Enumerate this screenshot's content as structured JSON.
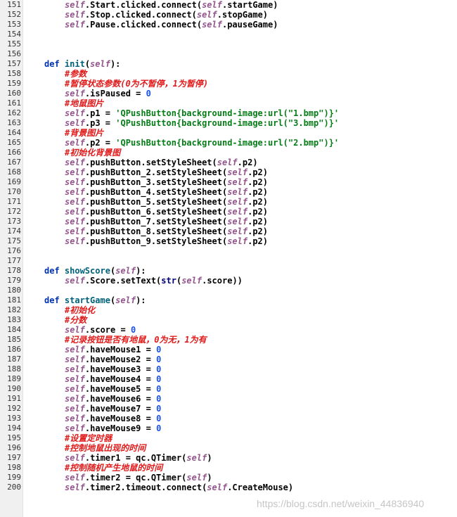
{
  "colors": {
    "self": "#94558d",
    "keyword": "#0033b3",
    "function": "#00627a",
    "number": "#1750eb",
    "string": "#067d17",
    "comment": "#e01b1b",
    "builtin": "#000080"
  },
  "watermark": "https://blog.csdn.net/weixin_44836940",
  "lines": [
    {
      "n": "151",
      "indent": 2,
      "tokens": [
        [
          "self",
          "self"
        ],
        [
          "plain",
          ".Start.clicked.connect("
        ],
        [
          "self",
          "self"
        ],
        [
          "plain",
          ".startGame)"
        ]
      ]
    },
    {
      "n": "152",
      "indent": 2,
      "tokens": [
        [
          "self",
          "self"
        ],
        [
          "plain",
          ".Stop.clicked.connect("
        ],
        [
          "self",
          "self"
        ],
        [
          "plain",
          ".stopGame)"
        ]
      ]
    },
    {
      "n": "153",
      "indent": 2,
      "tokens": [
        [
          "self",
          "self"
        ],
        [
          "plain",
          ".Pause.clicked.connect("
        ],
        [
          "self",
          "self"
        ],
        [
          "plain",
          ".pauseGame)"
        ]
      ]
    },
    {
      "n": "154",
      "indent": 0,
      "tokens": []
    },
    {
      "n": "155",
      "indent": 0,
      "tokens": []
    },
    {
      "n": "156",
      "indent": 0,
      "tokens": []
    },
    {
      "n": "157",
      "indent": 1,
      "tokens": [
        [
          "kw",
          "def "
        ],
        [
          "fn",
          "init"
        ],
        [
          "plain",
          "("
        ],
        [
          "self",
          "self"
        ],
        [
          "plain",
          "):"
        ]
      ]
    },
    {
      "n": "158",
      "indent": 2,
      "tokens": [
        [
          "cmt",
          "#参数"
        ]
      ]
    },
    {
      "n": "159",
      "indent": 2,
      "tokens": [
        [
          "cmt",
          "#暂停状态参数(0为不暂停，1为暂停)"
        ]
      ]
    },
    {
      "n": "160",
      "indent": 2,
      "tokens": [
        [
          "self",
          "self"
        ],
        [
          "plain",
          ".isPaused = "
        ],
        [
          "num",
          "0"
        ]
      ]
    },
    {
      "n": "161",
      "indent": 2,
      "tokens": [
        [
          "cmt",
          "#地鼠图片"
        ]
      ]
    },
    {
      "n": "162",
      "indent": 2,
      "tokens": [
        [
          "self",
          "self"
        ],
        [
          "plain",
          ".p1 = "
        ],
        [
          "str",
          "'QPushButton{background-image:url(\"1.bmp\")}'"
        ]
      ]
    },
    {
      "n": "163",
      "indent": 2,
      "tokens": [
        [
          "self",
          "self"
        ],
        [
          "plain",
          ".p3 = "
        ],
        [
          "str",
          "'QPushButton{background-image:url(\"3.bmp\")}'"
        ]
      ]
    },
    {
      "n": "164",
      "indent": 2,
      "tokens": [
        [
          "cmt",
          "#背景图片"
        ]
      ]
    },
    {
      "n": "165",
      "indent": 2,
      "tokens": [
        [
          "self",
          "self"
        ],
        [
          "plain",
          ".p2 = "
        ],
        [
          "str",
          "'QPushButton{background-image:url(\"2.bmp\")}'"
        ]
      ]
    },
    {
      "n": "166",
      "indent": 2,
      "tokens": [
        [
          "cmt",
          "#初始化背景图"
        ]
      ]
    },
    {
      "n": "167",
      "indent": 2,
      "tokens": [
        [
          "self",
          "self"
        ],
        [
          "plain",
          ".pushButton.setStyleSheet("
        ],
        [
          "self",
          "self"
        ],
        [
          "plain",
          ".p2)"
        ]
      ]
    },
    {
      "n": "168",
      "indent": 2,
      "tokens": [
        [
          "self",
          "self"
        ],
        [
          "plain",
          ".pushButton_2.setStyleSheet("
        ],
        [
          "self",
          "self"
        ],
        [
          "plain",
          ".p2)"
        ]
      ]
    },
    {
      "n": "169",
      "indent": 2,
      "tokens": [
        [
          "self",
          "self"
        ],
        [
          "plain",
          ".pushButton_3.setStyleSheet("
        ],
        [
          "self",
          "self"
        ],
        [
          "plain",
          ".p2)"
        ]
      ]
    },
    {
      "n": "170",
      "indent": 2,
      "tokens": [
        [
          "self",
          "self"
        ],
        [
          "plain",
          ".pushButton_4.setStyleSheet("
        ],
        [
          "self",
          "self"
        ],
        [
          "plain",
          ".p2)"
        ]
      ]
    },
    {
      "n": "171",
      "indent": 2,
      "tokens": [
        [
          "self",
          "self"
        ],
        [
          "plain",
          ".pushButton_5.setStyleSheet("
        ],
        [
          "self",
          "self"
        ],
        [
          "plain",
          ".p2)"
        ]
      ]
    },
    {
      "n": "172",
      "indent": 2,
      "tokens": [
        [
          "self",
          "self"
        ],
        [
          "plain",
          ".pushButton_6.setStyleSheet("
        ],
        [
          "self",
          "self"
        ],
        [
          "plain",
          ".p2)"
        ]
      ]
    },
    {
      "n": "173",
      "indent": 2,
      "tokens": [
        [
          "self",
          "self"
        ],
        [
          "plain",
          ".pushButton_7.setStyleSheet("
        ],
        [
          "self",
          "self"
        ],
        [
          "plain",
          ".p2)"
        ]
      ]
    },
    {
      "n": "174",
      "indent": 2,
      "tokens": [
        [
          "self",
          "self"
        ],
        [
          "plain",
          ".pushButton_8.setStyleSheet("
        ],
        [
          "self",
          "self"
        ],
        [
          "plain",
          ".p2)"
        ]
      ]
    },
    {
      "n": "175",
      "indent": 2,
      "tokens": [
        [
          "self",
          "self"
        ],
        [
          "plain",
          ".pushButton_9.setStyleSheet("
        ],
        [
          "self",
          "self"
        ],
        [
          "plain",
          ".p2)"
        ]
      ]
    },
    {
      "n": "176",
      "indent": 0,
      "tokens": []
    },
    {
      "n": "177",
      "indent": 0,
      "tokens": []
    },
    {
      "n": "178",
      "indent": 1,
      "tokens": [
        [
          "kw",
          "def "
        ],
        [
          "fn",
          "showScore"
        ],
        [
          "plain",
          "("
        ],
        [
          "self",
          "self"
        ],
        [
          "plain",
          "):"
        ]
      ]
    },
    {
      "n": "179",
      "indent": 2,
      "tokens": [
        [
          "self",
          "self"
        ],
        [
          "plain",
          ".Score.setText("
        ],
        [
          "builtin",
          "str"
        ],
        [
          "plain",
          "("
        ],
        [
          "self",
          "self"
        ],
        [
          "plain",
          ".score))"
        ]
      ]
    },
    {
      "n": "180",
      "indent": 0,
      "tokens": []
    },
    {
      "n": "181",
      "indent": 1,
      "tokens": [
        [
          "kw",
          "def "
        ],
        [
          "fn",
          "startGame"
        ],
        [
          "plain",
          "("
        ],
        [
          "self",
          "self"
        ],
        [
          "plain",
          "):"
        ]
      ]
    },
    {
      "n": "182",
      "indent": 2,
      "tokens": [
        [
          "cmt",
          "#初始化"
        ]
      ]
    },
    {
      "n": "183",
      "indent": 2,
      "tokens": [
        [
          "cmt",
          "#分数"
        ]
      ]
    },
    {
      "n": "184",
      "indent": 2,
      "tokens": [
        [
          "self",
          "self"
        ],
        [
          "plain",
          ".score = "
        ],
        [
          "num",
          "0"
        ]
      ]
    },
    {
      "n": "185",
      "indent": 2,
      "tokens": [
        [
          "cmt",
          "#记录按钮是否有地鼠，0为无，1为有"
        ]
      ]
    },
    {
      "n": "186",
      "indent": 2,
      "tokens": [
        [
          "self",
          "self"
        ],
        [
          "plain",
          ".haveMouse1 = "
        ],
        [
          "num",
          "0"
        ]
      ]
    },
    {
      "n": "187",
      "indent": 2,
      "tokens": [
        [
          "self",
          "self"
        ],
        [
          "plain",
          ".haveMouse2 = "
        ],
        [
          "num",
          "0"
        ]
      ]
    },
    {
      "n": "188",
      "indent": 2,
      "tokens": [
        [
          "self",
          "self"
        ],
        [
          "plain",
          ".haveMouse3 = "
        ],
        [
          "num",
          "0"
        ]
      ]
    },
    {
      "n": "189",
      "indent": 2,
      "tokens": [
        [
          "self",
          "self"
        ],
        [
          "plain",
          ".haveMouse4 = "
        ],
        [
          "num",
          "0"
        ]
      ]
    },
    {
      "n": "190",
      "indent": 2,
      "tokens": [
        [
          "self",
          "self"
        ],
        [
          "plain",
          ".haveMouse5 = "
        ],
        [
          "num",
          "0"
        ]
      ]
    },
    {
      "n": "191",
      "indent": 2,
      "tokens": [
        [
          "self",
          "self"
        ],
        [
          "plain",
          ".haveMouse6 = "
        ],
        [
          "num",
          "0"
        ]
      ]
    },
    {
      "n": "192",
      "indent": 2,
      "tokens": [
        [
          "self",
          "self"
        ],
        [
          "plain",
          ".haveMouse7 = "
        ],
        [
          "num",
          "0"
        ]
      ]
    },
    {
      "n": "193",
      "indent": 2,
      "tokens": [
        [
          "self",
          "self"
        ],
        [
          "plain",
          ".haveMouse8 = "
        ],
        [
          "num",
          "0"
        ]
      ]
    },
    {
      "n": "194",
      "indent": 2,
      "tokens": [
        [
          "self",
          "self"
        ],
        [
          "plain",
          ".haveMouse9 = "
        ],
        [
          "num",
          "0"
        ]
      ]
    },
    {
      "n": "195",
      "indent": 2,
      "tokens": [
        [
          "cmt",
          "#设置定时器"
        ]
      ]
    },
    {
      "n": "196",
      "indent": 2,
      "tokens": [
        [
          "cmt",
          "#控制地鼠出现的时间"
        ]
      ]
    },
    {
      "n": "197",
      "indent": 2,
      "tokens": [
        [
          "self",
          "self"
        ],
        [
          "plain",
          ".timer1 = qc.QTimer("
        ],
        [
          "self",
          "self"
        ],
        [
          "plain",
          ")"
        ]
      ]
    },
    {
      "n": "198",
      "indent": 2,
      "tokens": [
        [
          "cmt",
          "#控制随机产生地鼠的时间"
        ]
      ]
    },
    {
      "n": "199",
      "indent": 2,
      "tokens": [
        [
          "self",
          "self"
        ],
        [
          "plain",
          ".timer2 = qc.QTimer("
        ],
        [
          "self",
          "self"
        ],
        [
          "plain",
          ")"
        ]
      ]
    },
    {
      "n": "200",
      "indent": 2,
      "tokens": [
        [
          "self",
          "self"
        ],
        [
          "plain",
          ".timer2.timeout.connect("
        ],
        [
          "self",
          "self"
        ],
        [
          "plain",
          ".CreateMouse)"
        ]
      ]
    }
  ]
}
